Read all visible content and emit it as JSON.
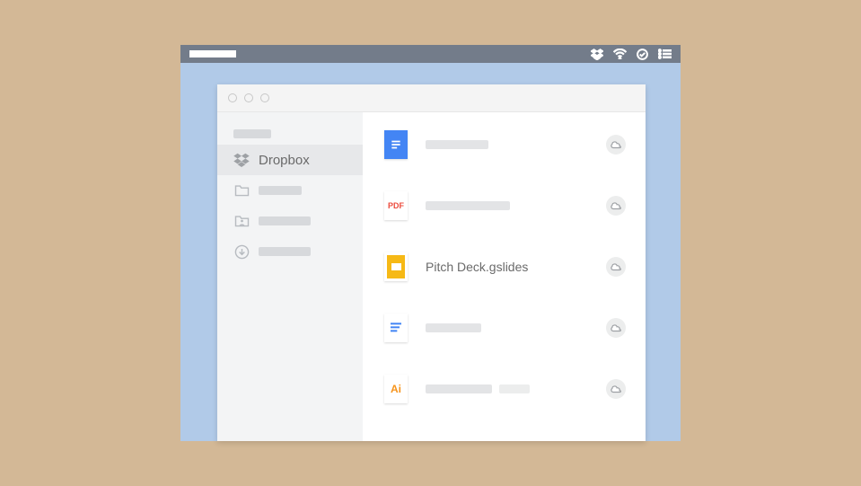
{
  "menubar": {
    "icons": [
      "dropbox-icon",
      "wifi-icon",
      "sync-ok-icon",
      "list-icon"
    ]
  },
  "window": {
    "traffic_lights": 3
  },
  "sidebar": {
    "heading_placeholder_w": 42,
    "items": [
      {
        "kind": "dropbox",
        "label": "Dropbox",
        "selected": true
      },
      {
        "kind": "folder",
        "placeholder_w": 48
      },
      {
        "kind": "person-folder",
        "placeholder_w": 58
      },
      {
        "kind": "download",
        "placeholder_w": 58
      }
    ]
  },
  "files": [
    {
      "type": "gdoc",
      "name": null,
      "placeholders": [
        70
      ]
    },
    {
      "type": "pdf",
      "name": null,
      "placeholders": [
        94
      ]
    },
    {
      "type": "gslides",
      "name": "Pitch Deck.gslides",
      "placeholders": []
    },
    {
      "type": "text",
      "name": null,
      "placeholders": [
        62
      ]
    },
    {
      "type": "ai",
      "name": null,
      "placeholders": [
        74,
        34
      ]
    }
  ],
  "file_type_labels": {
    "pdf": "PDF",
    "ai": "Ai"
  }
}
